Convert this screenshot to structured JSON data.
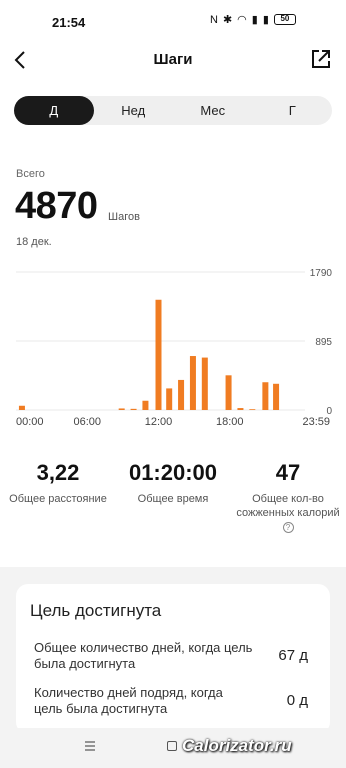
{
  "status_bar": {
    "time": "21:54",
    "battery": "50"
  },
  "header": {
    "title": "Шаги"
  },
  "tabs": [
    {
      "label": "Д",
      "active": true
    },
    {
      "label": "Нед",
      "active": false
    },
    {
      "label": "Мес",
      "active": false
    },
    {
      "label": "Г",
      "active": false
    }
  ],
  "summary": {
    "label": "Всего",
    "value": "4870",
    "unit": "Шагов",
    "date": "18 дек."
  },
  "chart_data": {
    "type": "bar",
    "x_tick_labels": [
      "00:00",
      "06:00",
      "12:00",
      "18:00",
      "23:59"
    ],
    "y_tick_labels": [
      "1790",
      "895",
      "0"
    ],
    "ylim": [
      0,
      1790
    ],
    "bar_color": "#f07c22",
    "x_hours": [
      0.5,
      8.9,
      9.9,
      10.9,
      12.0,
      12.9,
      13.9,
      14.9,
      15.9,
      17.9,
      18.9,
      19.9,
      21.0,
      21.9
    ],
    "values": [
      55,
      20,
      15,
      120,
      1430,
      280,
      390,
      700,
      680,
      450,
      25,
      10,
      360,
      340
    ]
  },
  "stats": [
    {
      "value": "3,22",
      "label": "Общее расстояние"
    },
    {
      "value": "01:20:00",
      "label": "Общее время"
    },
    {
      "value": "47",
      "label": "Общее кол-во сожженных калорий"
    }
  ],
  "goal": {
    "title": "Цель достигнута",
    "rows": [
      {
        "label": "Общее количество дней, когда цель была достигнута",
        "value": "67 д"
      },
      {
        "label": "Количество дней подряд, когда цель была достигнута",
        "value": "0 д"
      }
    ]
  },
  "watermark": "Calorizator.ru",
  "colors": {
    "accent": "#f07c22",
    "active_tab": "#1a1a1a"
  }
}
